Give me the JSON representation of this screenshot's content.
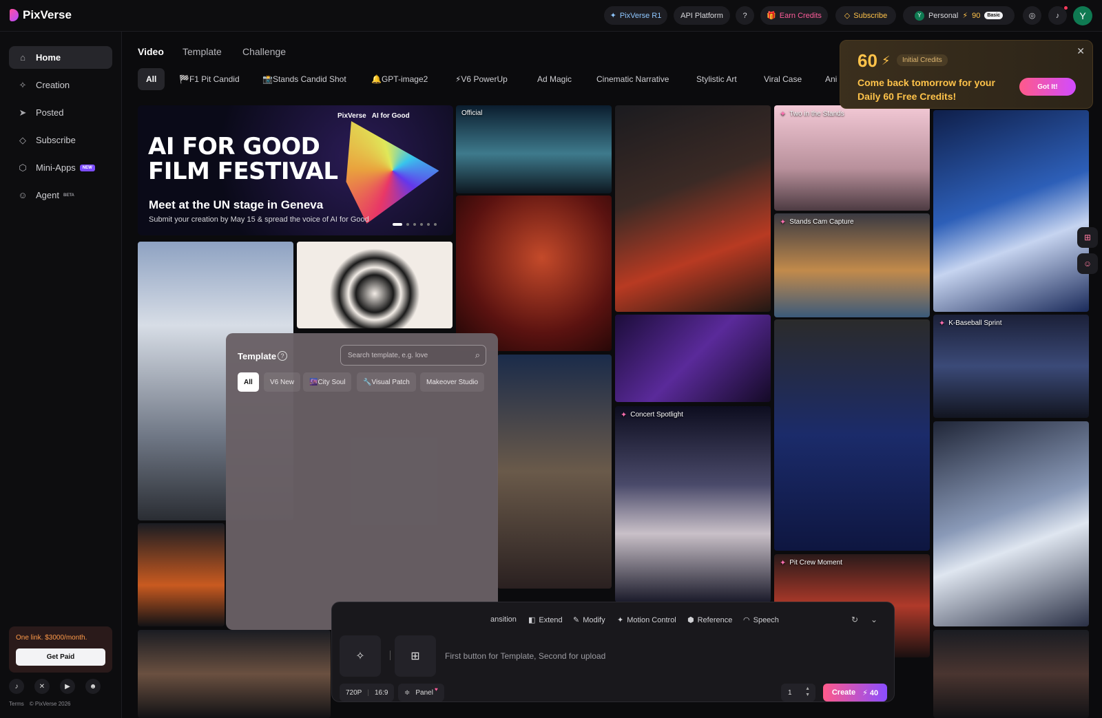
{
  "brand": {
    "name": "PixVerse"
  },
  "topbar": {
    "pixverse_r1": "PixVerse R1",
    "api_platform": "API Platform",
    "earn_credits": "Earn Credits",
    "subscribe": "Subscribe",
    "account": {
      "initial": "Y",
      "label": "Personal",
      "credits": "90",
      "plan": "Basic"
    },
    "avatar_initial": "Y"
  },
  "sidebar": {
    "items": [
      {
        "label": "Home",
        "icon": "home-icon"
      },
      {
        "label": "Creation",
        "icon": "sparkle-icon"
      },
      {
        "label": "Posted",
        "icon": "send-icon"
      },
      {
        "label": "Subscribe",
        "icon": "diamond-icon"
      },
      {
        "label": "Mini-Apps",
        "icon": "cube-icon",
        "badge": "NEW"
      },
      {
        "label": "Agent",
        "icon": "robot-icon",
        "badge": "BETA"
      }
    ],
    "promo": {
      "text": "One link. $3000/month.",
      "button": "Get Paid"
    },
    "footer": {
      "terms": "Terms",
      "copyright": "© PixVerse 2026"
    }
  },
  "main_tabs": [
    "Video",
    "Template",
    "Challenge"
  ],
  "categories": [
    "All",
    "🏁F1 Pit Candid",
    "📸Stands Candid Shot",
    "🔔GPT-image2",
    "⚡V6 PowerUp",
    "Ad Magic",
    "Cinematic Narrative",
    "Stylistic Art",
    "Viral Case",
    "Ani"
  ],
  "banner": {
    "title": "AI FOR GOOD\nFILM FESTIVAL",
    "subtitle": "Meet at the UN stage in Geneva",
    "text": "Submit your creation by May 15 & spread the voice of AI for Good",
    "logo_a": "PixVerse",
    "logo_b": "AI for Good"
  },
  "tiles": {
    "official": "Official",
    "two_in_stands": "Two in the Stands",
    "stands_cam": "Stands Cam Capture",
    "k_baseball": "K-Baseball Sprint",
    "concert": "Concert Spotlight",
    "pit_crew": "Pit Crew Moment"
  },
  "template_panel": {
    "title": "Template",
    "search_placeholder": "Search template, e.g. love",
    "chips": [
      "All",
      "V6 New",
      "🌆City Soul",
      "🔧Visual Patch",
      "Makeover Studio"
    ]
  },
  "create_bar": {
    "tools": [
      "ansition",
      "Extend",
      "Modify",
      "Motion Control",
      "Reference",
      "Speech"
    ],
    "placeholder": "First button for Template, Second for upload",
    "resolution": "720P",
    "ratio": "16:9",
    "panel": "Panel",
    "count": "1",
    "create": "Create",
    "cost": "40"
  },
  "credits_popup": {
    "amount": "60",
    "tag": "Initial Credits",
    "message": "Come back tomorrow for your Daily 60 Free Credits!",
    "button": "Got It!"
  }
}
